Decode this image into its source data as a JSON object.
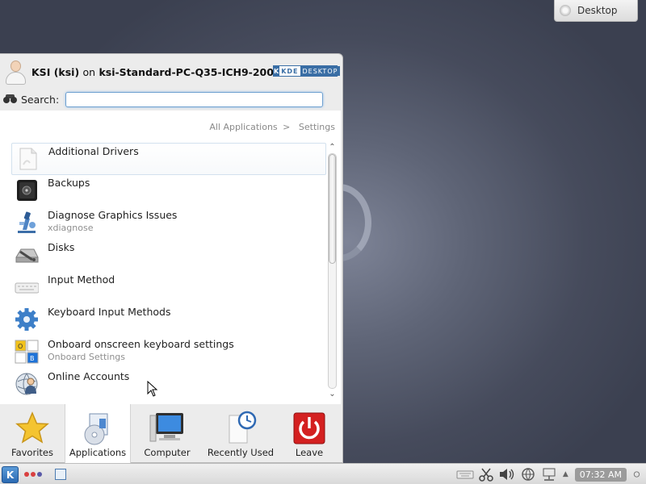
{
  "desktop": {
    "toolbox_label": "Desktop"
  },
  "launcher": {
    "user_name": "KSI (ksi)",
    "on_word": "on",
    "host": "ksi-Standard-PC-Q35-ICH9-2009",
    "badge_kde": "KDE",
    "badge_desktop": "DESKTOP",
    "search_label": "Search:",
    "search_value": "",
    "breadcrumb": {
      "root": "All Applications",
      "separator": ">",
      "current": "Settings"
    },
    "items": [
      {
        "name": "Additional Drivers",
        "sub": "",
        "icon": "document-icon"
      },
      {
        "name": "Backups",
        "sub": "",
        "icon": "safe-icon"
      },
      {
        "name": "Diagnose Graphics Issues",
        "sub": "xdiagnose",
        "icon": "microscope-icon"
      },
      {
        "name": "Disks",
        "sub": "",
        "icon": "disk-utility-icon"
      },
      {
        "name": "Input Method",
        "sub": "",
        "icon": "keyboard-icon"
      },
      {
        "name": "Keyboard Input Methods",
        "sub": "",
        "icon": "gear-icon"
      },
      {
        "name": "Onboard onscreen keyboard settings",
        "sub": "Onboard Settings",
        "icon": "onboard-icon"
      },
      {
        "name": "Online Accounts",
        "sub": "",
        "icon": "online-accounts-icon"
      }
    ],
    "tabs": [
      {
        "label": "Favorites",
        "icon": "star-icon"
      },
      {
        "label": "Applications",
        "icon": "applications-icon"
      },
      {
        "label": "Computer",
        "icon": "monitor-icon"
      },
      {
        "label": "Recently Used",
        "icon": "clock-document-icon"
      },
      {
        "label": "Leave",
        "icon": "power-icon"
      }
    ],
    "active_tab": "Applications"
  },
  "taskbar": {
    "clock": "07:32 AM",
    "activity_colors": [
      "#d94040",
      "#d94040",
      "#5a5aa8"
    ]
  },
  "colors": {
    "accent": "#3a6ea5",
    "leave_red": "#d42020"
  }
}
